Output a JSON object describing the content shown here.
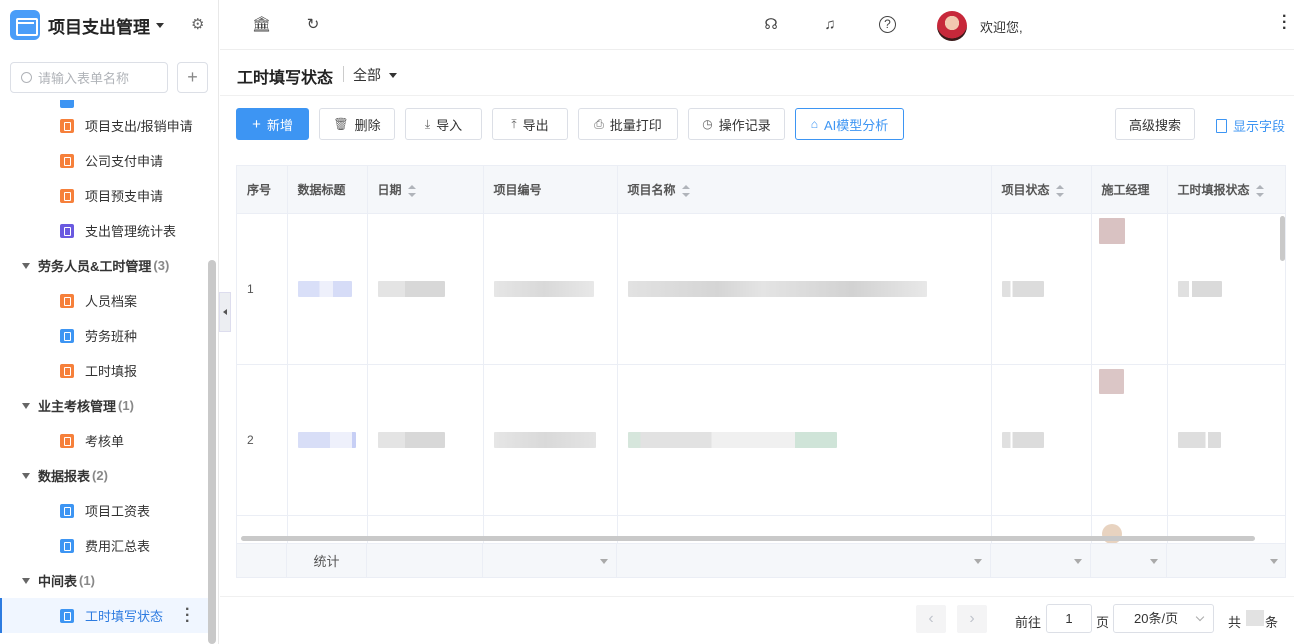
{
  "app": {
    "title": "项目支出管理"
  },
  "search": {
    "placeholder": "请输入表单名称",
    "add_label": "+"
  },
  "tree": [
    {
      "type": "leaf",
      "label": "项目支出/报销申请",
      "color": "o"
    },
    {
      "type": "leaf",
      "label": "公司支付申请",
      "color": "o"
    },
    {
      "type": "leaf",
      "label": "项目预支申请",
      "color": "o"
    },
    {
      "type": "leaf",
      "label": "支出管理统计表",
      "color": "p"
    },
    {
      "type": "group",
      "label": "劳务人员&工时管理",
      "count": "(3)"
    },
    {
      "type": "leaf",
      "label": "人员档案",
      "color": "o"
    },
    {
      "type": "leaf",
      "label": "劳务班种",
      "color": "b"
    },
    {
      "type": "leaf",
      "label": "工时填报",
      "color": "o"
    },
    {
      "type": "group",
      "label": "业主考核管理",
      "count": "(1)"
    },
    {
      "type": "leaf",
      "label": "考核单",
      "color": "o"
    },
    {
      "type": "group",
      "label": "数据报表",
      "count": "(2)"
    },
    {
      "type": "leaf",
      "label": "项目工资表",
      "color": "b"
    },
    {
      "type": "leaf",
      "label": "费用汇总表",
      "color": "b"
    },
    {
      "type": "group",
      "label": "中间表",
      "count": "(1)"
    },
    {
      "type": "leaf",
      "label": "工时填写状态",
      "color": "b",
      "active": true
    }
  ],
  "header": {
    "welcome": "欢迎您,"
  },
  "page": {
    "title": "工时填写状态",
    "filter": "全部"
  },
  "toolbar": {
    "add": "新增",
    "delete": "删除",
    "import": "导入",
    "export": "导出",
    "batch_print": "批量打印",
    "op_log": "操作记录",
    "ai": "AI模型分析",
    "advanced_search": "高级搜索",
    "show_fields": "显示字段"
  },
  "table": {
    "columns": [
      "序号",
      "数据标题",
      "日期",
      "项目编号",
      "项目名称",
      "项目状态",
      "施工经理",
      "工时填报状态"
    ],
    "rows": [
      {
        "index": "1"
      },
      {
        "index": "2"
      }
    ],
    "summary_label": "统计"
  },
  "pager": {
    "goto": "前往",
    "page": "1",
    "page_unit": "页",
    "page_size": "20条/页",
    "total_prefix": "共",
    "total_suffix": "条"
  }
}
